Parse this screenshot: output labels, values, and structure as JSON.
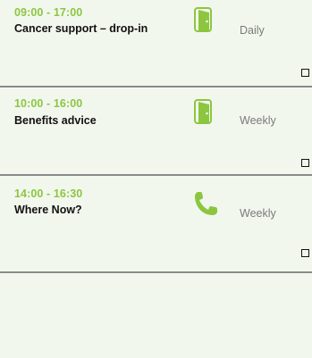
{
  "sessions": [
    {
      "time": "09:00 - 17:00",
      "title": "Cancer support – drop-in",
      "icon": "door-icon",
      "frequency": "Daily"
    },
    {
      "time": "10:00 - 16:00",
      "title": "Benefits advice",
      "icon": "door-icon",
      "frequency": "Weekly"
    },
    {
      "time": "14:00 - 16:30",
      "title": "Where Now?",
      "icon": "phone-icon",
      "frequency": "Weekly"
    }
  ],
  "colors": {
    "accent": "#8cc63f",
    "background": "#f2f7ee",
    "divider": "#8a8a8a",
    "muted_text": "#7a7a7a"
  }
}
